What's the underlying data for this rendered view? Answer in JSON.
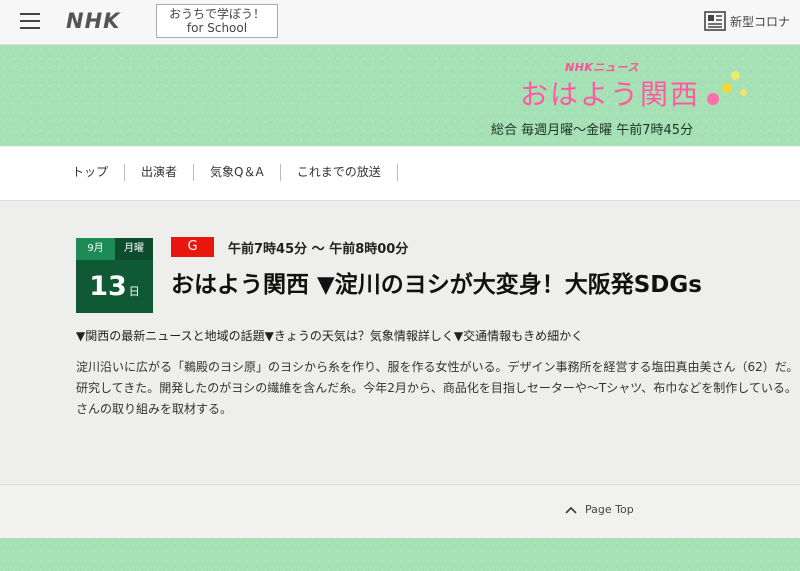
{
  "header": {
    "logo": "NHK",
    "school_line1": "おうちで学ぼう！",
    "school_line2": "for School",
    "corona_label": "新型コロナ"
  },
  "banner": {
    "sub": "NHKニュース",
    "title": "おはよう関西",
    "time": "総合 毎週月曜〜金曜 午前7時45分"
  },
  "nav": {
    "items": [
      "トップ",
      "出演者",
      "気象Q＆A",
      "これまでの放送"
    ]
  },
  "program": {
    "month": "9月",
    "dow": "月曜",
    "day": "13",
    "day_suffix": "日",
    "channel": "G",
    "airtime": "午前7時45分 〜 午前8時00分",
    "title": "おはよう関西 ▼淀川のヨシが大変身！大阪発SDGs",
    "summary": "▼関西の最新ニュースと地域の話題▼きょうの天気は？気象情報詳しく▼交通情報もきめ細かく",
    "desc_lines": [
      "淀川沿いに広がる「鵜殿のヨシ原」のヨシから糸を作り、服を作る女性がいる。デザイン事務所を経営する塩田真由美さん（62）だ。",
      "研究してきた。開発したのがヨシの繊維を含んだ糸。今年2月から、商品化を目指しセーターや〜Tシャツ、布巾などを制作している。",
      "さんの取り組みを取材する。"
    ]
  },
  "footer": {
    "page_top": "Page Top"
  },
  "colors": {
    "banner_green": "#a5e1b4",
    "title_pink": "#ff5aa2",
    "badge_red": "#e8160c",
    "date_green": "#0f5a34"
  }
}
